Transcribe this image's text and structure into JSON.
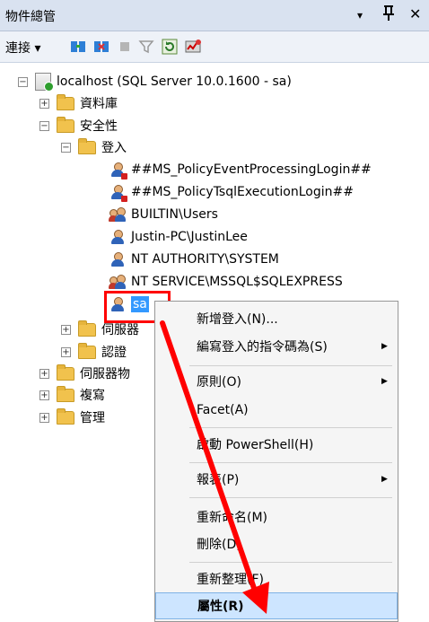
{
  "window": {
    "title": "物件總管",
    "dropdown_icon": "▾",
    "pin_icon": "ꟷ",
    "close_icon": "✕"
  },
  "toolbar": {
    "connect_label": "連接 ▾"
  },
  "tree": {
    "server": "localhost (SQL Server 10.0.1600 - sa)",
    "databases": "資料庫",
    "security": "安全性",
    "logins": "登入",
    "login_items": [
      "##MS_PolicyEventProcessingLogin##",
      "##MS_PolicyTsqlExecutionLogin##",
      "BUILTIN\\Users",
      "Justin-PC\\JustinLee",
      "NT AUTHORITY\\SYSTEM",
      "NT SERVICE\\MSSQL$SQLEXPRESS",
      "sa"
    ],
    "server_roles_partial": "伺服器",
    "credentials": "認證",
    "server_objects_partial": "伺服器物",
    "replication": "複寫",
    "management": "管理"
  },
  "context_menu": {
    "new_login": "新增登入(N)...",
    "script_login": "編寫登入的指令碼為(S)",
    "policies": "原則(O)",
    "facets": "Facet(A)",
    "powershell": "啟動 PowerShell(H)",
    "reports": "報表(P)",
    "rename": "重新命名(M)",
    "delete": "刪除(D)",
    "refresh": "重新整理(F)",
    "properties": "屬性(R)"
  },
  "colors": {
    "highlight": "#3399ff",
    "annotation": "#ff0000"
  }
}
